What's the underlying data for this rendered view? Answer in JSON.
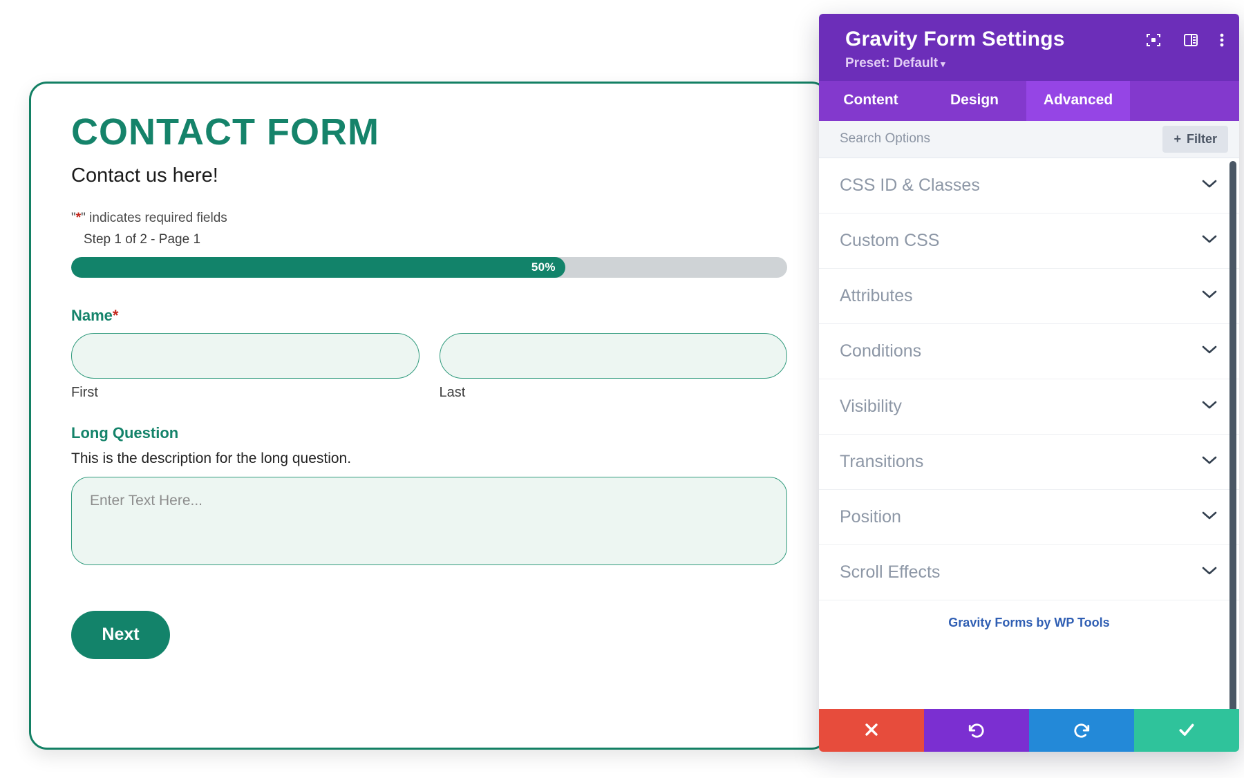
{
  "form": {
    "title": "CONTACT FORM",
    "subtitle": "Contact us here!",
    "required_note_pre": "\"",
    "required_note_star": "*",
    "required_note_post": "\" indicates required fields",
    "step_label": "Step 1 of 2 - Page 1",
    "progress": {
      "percent_label": "50%",
      "value": 50,
      "fill_color": "#12836a",
      "track_color": "#cfd3d6"
    },
    "fields": [
      {
        "label": "Name",
        "required_star": "*",
        "sub_fields": [
          {
            "value": "",
            "placeholder": "",
            "sub_label": "First"
          },
          {
            "value": "",
            "placeholder": "",
            "sub_label": "Last"
          }
        ]
      },
      {
        "label": "Long Question",
        "description": "This is the description for the long question.",
        "value": "",
        "placeholder": "Enter Text Here..."
      }
    ],
    "next_button": "Next",
    "accent_color": "#13836a"
  },
  "panel": {
    "title": "Gravity Form Settings",
    "preset_label": "Preset: Default",
    "preset_caret": "▾",
    "header_icons": [
      {
        "name": "focus-target-icon"
      },
      {
        "name": "layout-panel-icon"
      },
      {
        "name": "more-vertical-icon"
      }
    ],
    "tabs": [
      {
        "label": "Content",
        "active": false
      },
      {
        "label": "Design",
        "active": false
      },
      {
        "label": "Advanced",
        "active": true
      }
    ],
    "search": {
      "value": "",
      "placeholder": "Search Options"
    },
    "filter_button": {
      "label": "Filter",
      "plus": "+"
    },
    "accordion_items": [
      {
        "label": "CSS ID & Classes"
      },
      {
        "label": "Custom CSS"
      },
      {
        "label": "Attributes"
      },
      {
        "label": "Conditions"
      },
      {
        "label": "Visibility"
      },
      {
        "label": "Transitions"
      },
      {
        "label": "Position"
      },
      {
        "label": "Scroll Effects"
      }
    ],
    "credit_link": "Gravity Forms by WP Tools",
    "footer_buttons": [
      {
        "name": "close-button",
        "icon": "close-icon",
        "color": "#e74c3c"
      },
      {
        "name": "undo-button",
        "icon": "undo-icon",
        "color": "#7b2fd1"
      },
      {
        "name": "redo-button",
        "icon": "redo-icon",
        "color": "#2389d8"
      },
      {
        "name": "save-button",
        "icon": "check-icon",
        "color": "#2fc39b"
      }
    ],
    "header_color": "#6c2eb9",
    "tabbar_color": "#8339cd",
    "active_tab_color": "#9545e5"
  }
}
